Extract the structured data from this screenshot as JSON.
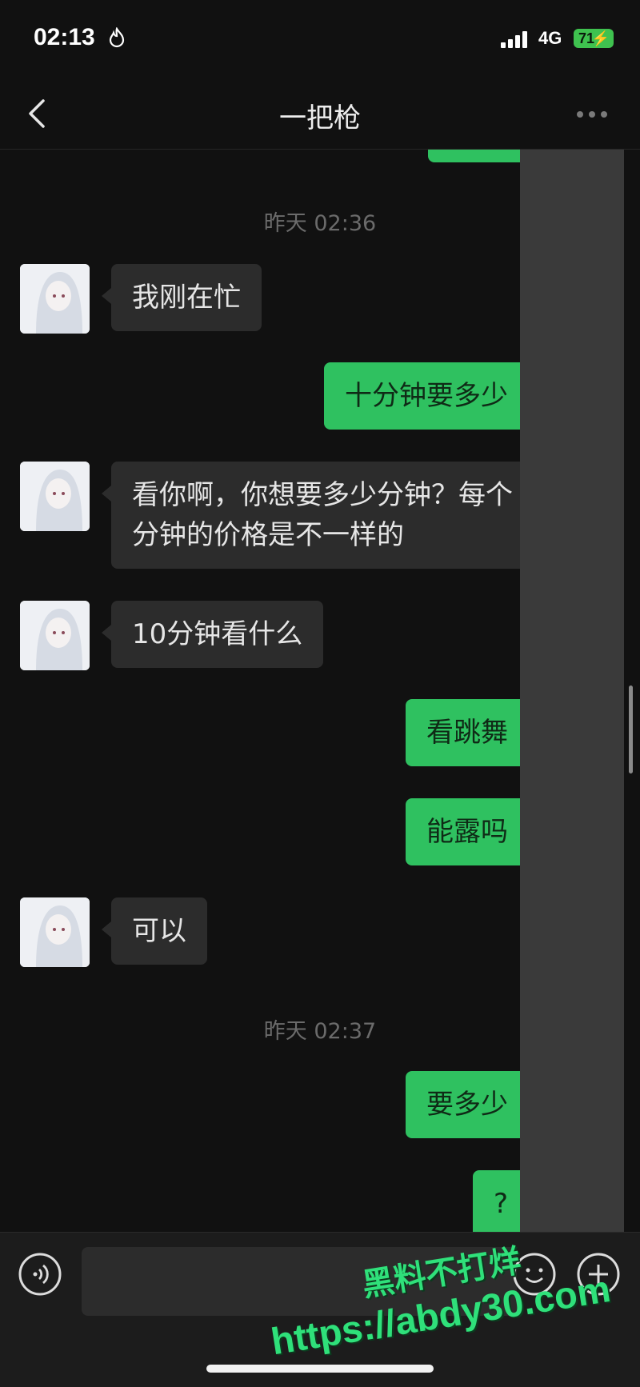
{
  "status_bar": {
    "time": "02:13",
    "network": "4G",
    "battery": "71"
  },
  "nav": {
    "title": "一把枪"
  },
  "timestamps": [
    "昨天 02:36",
    "昨天 02:37"
  ],
  "messages": [
    {
      "side": "left",
      "text": "我刚在忙"
    },
    {
      "side": "right",
      "text": "十分钟要多少"
    },
    {
      "side": "left",
      "text": "看你啊，你想要多少分钟？每个分钟的价格是不一样的"
    },
    {
      "side": "left",
      "text": "10分钟看什么"
    },
    {
      "side": "right",
      "text": "看跳舞"
    },
    {
      "side": "right",
      "text": "能露吗"
    },
    {
      "side": "left",
      "text": "可以"
    },
    {
      "side": "right",
      "text": "要多少"
    },
    {
      "side": "right",
      "text": "?"
    }
  ],
  "watermark": {
    "line1": "黑料不打烊",
    "line2": "https://abdy30.com"
  },
  "colors": {
    "background": "#111111",
    "bubble_self": "#2fc160",
    "bubble_other": "#2c2c2c"
  },
  "icons": [
    "flame-icon",
    "signal-icon",
    "back-icon",
    "more-icon",
    "voice-icon",
    "emoji-icon",
    "add-icon"
  ]
}
